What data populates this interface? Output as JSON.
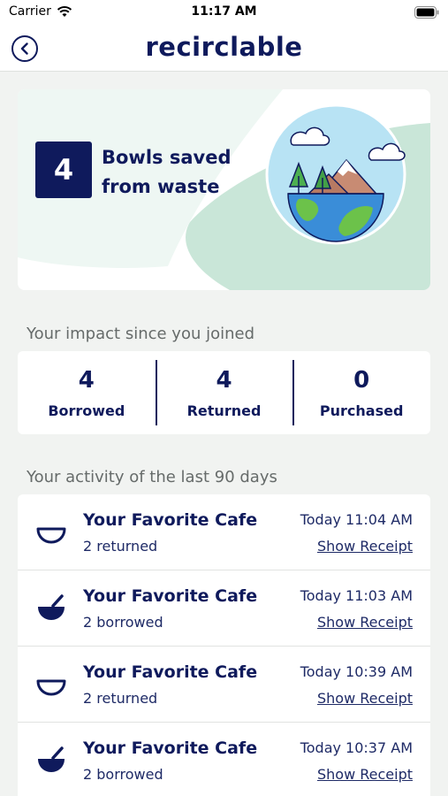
{
  "status_bar": {
    "carrier": "Carrier",
    "time": "11:17 AM"
  },
  "header": {
    "title": "recirclable"
  },
  "hero": {
    "count": "4",
    "text": "Bowls saved from waste"
  },
  "impact": {
    "title": "Your impact since you joined",
    "stats": [
      {
        "value": "4",
        "label": "Borrowed"
      },
      {
        "value": "4",
        "label": "Returned"
      },
      {
        "value": "0",
        "label": "Purchased"
      }
    ]
  },
  "activity": {
    "title": "Your activity of the last 90 days",
    "items": [
      {
        "place": "Your Favorite Cafe",
        "action": "2 returned",
        "time": "Today 11:04 AM",
        "link": "Show Receipt",
        "icon": "empty-bowl-icon"
      },
      {
        "place": "Your Favorite Cafe",
        "action": "2 borrowed",
        "time": "Today 11:03 AM",
        "link": "Show Receipt",
        "icon": "filled-bowl-icon"
      },
      {
        "place": "Your Favorite Cafe",
        "action": "2 returned",
        "time": "Today 10:39 AM",
        "link": "Show Receipt",
        "icon": "empty-bowl-icon"
      },
      {
        "place": "Your Favorite Cafe",
        "action": "2 borrowed",
        "time": "Today 10:37 AM",
        "link": "Show Receipt",
        "icon": "filled-bowl-icon"
      }
    ]
  },
  "colors": {
    "navy": "#0f1a5c",
    "mint": "#c9e6d8",
    "background": "#f1f3f1"
  }
}
